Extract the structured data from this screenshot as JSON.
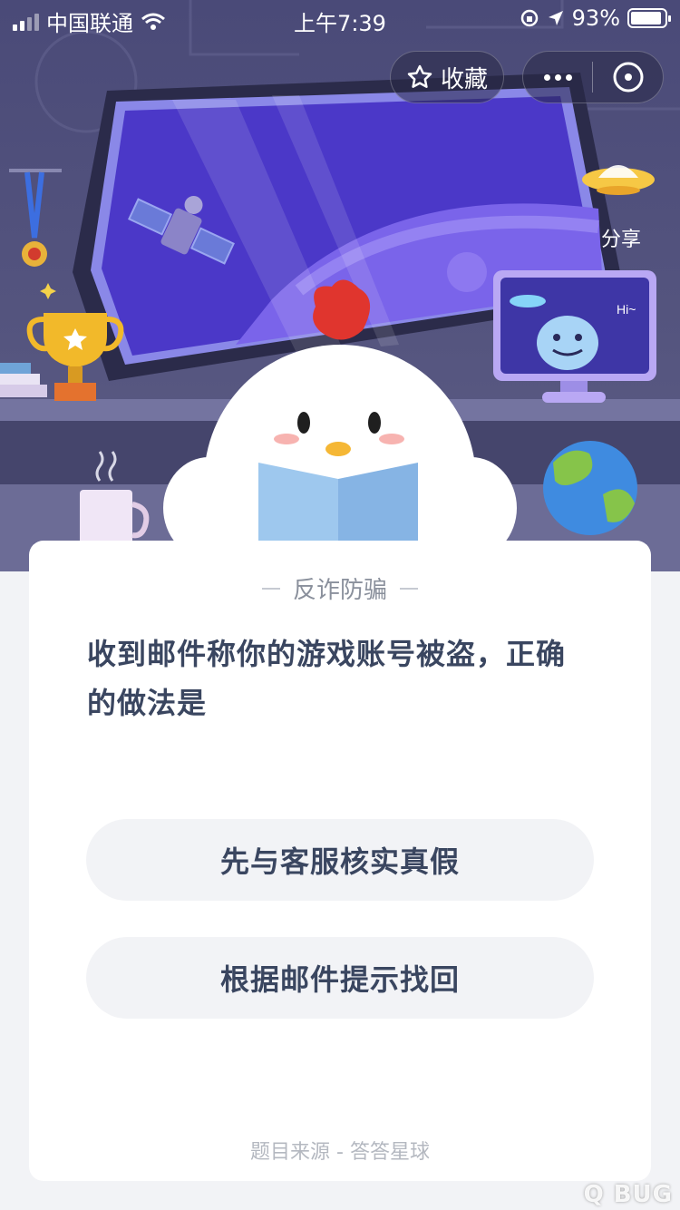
{
  "status_bar": {
    "carrier": "中国联通",
    "time": "上午7:39",
    "battery": "93%",
    "battery_level": 0.93
  },
  "toolbar": {
    "favorite_label": "收藏",
    "share_label": "分享"
  },
  "scene": {
    "monitor_text": "Hi~"
  },
  "quiz": {
    "category": "反诈防骗",
    "question": "收到邮件称你的游戏账号被盗，正确的做法是",
    "options": [
      {
        "label": "先与客服核实真假"
      },
      {
        "label": "根据邮件提示找回"
      }
    ],
    "source": "题目来源 - 答答星球"
  },
  "watermark": "Q BUG"
}
